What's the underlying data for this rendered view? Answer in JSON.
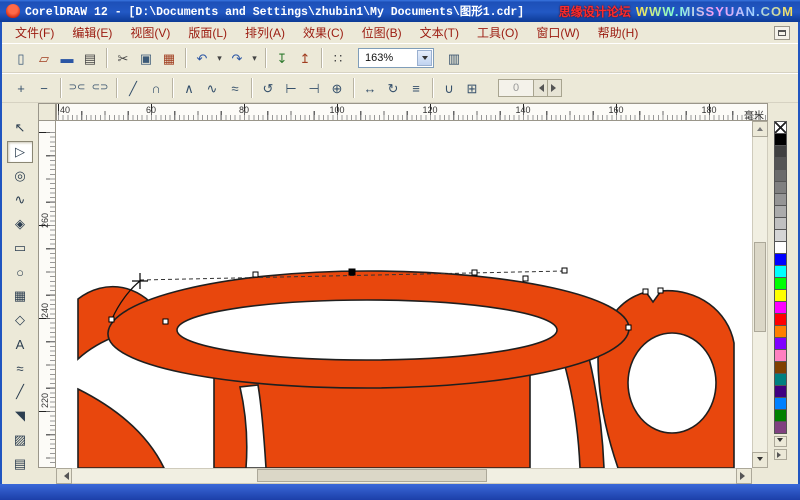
{
  "window": {
    "title": "CorelDRAW 12 - [D:\\Documents and Settings\\zhubin1\\My Documents\\图形1.cdr]",
    "watermark_1": "思缘设计论坛",
    "watermark_2": "WWW.MISSYUAN.COM"
  },
  "menu": {
    "items": [
      "文件(F)",
      "编辑(E)",
      "视图(V)",
      "版面(L)",
      "排列(A)",
      "效果(C)",
      "位图(B)",
      "文本(T)",
      "工具(O)",
      "窗口(W)",
      "帮助(H)"
    ]
  },
  "toolbar": {
    "caret": "▾",
    "zoom_value": "163%",
    "items": [
      {
        "name": "new",
        "glyph": "▯"
      },
      {
        "name": "open",
        "glyph": "▱"
      },
      {
        "name": "save",
        "glyph": "▬"
      },
      {
        "name": "print",
        "glyph": "▤"
      },
      {
        "name": "cut",
        "glyph": "✂"
      },
      {
        "name": "copy",
        "glyph": "▣"
      },
      {
        "name": "paste",
        "glyph": "▦"
      },
      {
        "name": "undo",
        "glyph": "↶"
      },
      {
        "name": "redo",
        "glyph": "↷"
      },
      {
        "name": "import",
        "glyph": "↧"
      },
      {
        "name": "export",
        "glyph": "↥"
      },
      {
        "name": "application-launcher",
        "glyph": "∷"
      },
      {
        "name": "corel-graph",
        "glyph": "▥"
      }
    ]
  },
  "property_bar": {
    "spinner_value": "0",
    "items": [
      {
        "name": "add-node",
        "glyph": "+"
      },
      {
        "name": "delete-node",
        "glyph": "−"
      },
      {
        "name": "join-nodes",
        "glyph": "⊃⊂"
      },
      {
        "name": "break-curve",
        "glyph": "⊂⊃"
      },
      {
        "name": "convert-to-line",
        "glyph": "╱"
      },
      {
        "name": "convert-to-curve",
        "glyph": "∩"
      },
      {
        "name": "make-cusp",
        "glyph": "∧"
      },
      {
        "name": "make-smooth",
        "glyph": "∿"
      },
      {
        "name": "make-symmetrical",
        "glyph": "≈"
      },
      {
        "name": "reverse-direction",
        "glyph": "↺"
      },
      {
        "name": "extend-curve",
        "glyph": "⊢"
      },
      {
        "name": "extract-subpath",
        "glyph": "⊣"
      },
      {
        "name": "auto-close-curve",
        "glyph": "⊕"
      },
      {
        "name": "stretch-nodes",
        "glyph": "↔"
      },
      {
        "name": "rotate-nodes",
        "glyph": "↻"
      },
      {
        "name": "align-nodes",
        "glyph": "≡"
      },
      {
        "name": "elastic-mode",
        "glyph": "∪"
      },
      {
        "name": "select-all-nodes",
        "glyph": "⊞"
      }
    ]
  },
  "rulers": {
    "unit": "毫米",
    "h_labels": [
      "40",
      "60",
      "80",
      "100",
      "120",
      "140",
      "160",
      "180"
    ],
    "v_labels": [
      "260",
      "240",
      "220"
    ]
  },
  "toolbox": {
    "tools": [
      {
        "name": "pick-tool",
        "glyph": "↖"
      },
      {
        "name": "shape-tool",
        "glyph": "▷"
      },
      {
        "name": "zoom-tool",
        "glyph": "◎"
      },
      {
        "name": "freehand-tool",
        "glyph": "∿"
      },
      {
        "name": "smart-drawing-tool",
        "glyph": "◈"
      },
      {
        "name": "rectangle-tool",
        "glyph": "▭"
      },
      {
        "name": "ellipse-tool",
        "glyph": "○"
      },
      {
        "name": "graph-paper-tool",
        "glyph": "▦"
      },
      {
        "name": "basic-shapes-tool",
        "glyph": "◇"
      },
      {
        "name": "text-tool",
        "glyph": "A"
      },
      {
        "name": "interactive-blend-tool",
        "glyph": "≈"
      },
      {
        "name": "eyedropper-tool",
        "glyph": "╱"
      },
      {
        "name": "outline-pen-tool",
        "glyph": "◥"
      },
      {
        "name": "fill-tool",
        "glyph": "▨"
      },
      {
        "name": "interactive-fill-tool",
        "glyph": "▤"
      }
    ]
  },
  "palette": {
    "colors": [
      "none",
      "#000000",
      "#404040",
      "#555555",
      "#6b6b6b",
      "#808080",
      "#959595",
      "#ababab",
      "#c0c0c0",
      "#d5d5d5",
      "#ffffff",
      "#0000ff",
      "#00ffff",
      "#00ff00",
      "#ffff00",
      "#ff00ff",
      "#ff0000",
      "#ff7f00",
      "#8000ff",
      "#ff80c0",
      "#804000",
      "#008080",
      "#400080",
      "#0080ff",
      "#008000",
      "#804080"
    ]
  },
  "colors": {
    "shape": "#e8470d",
    "outline": "#1f1f1f"
  }
}
